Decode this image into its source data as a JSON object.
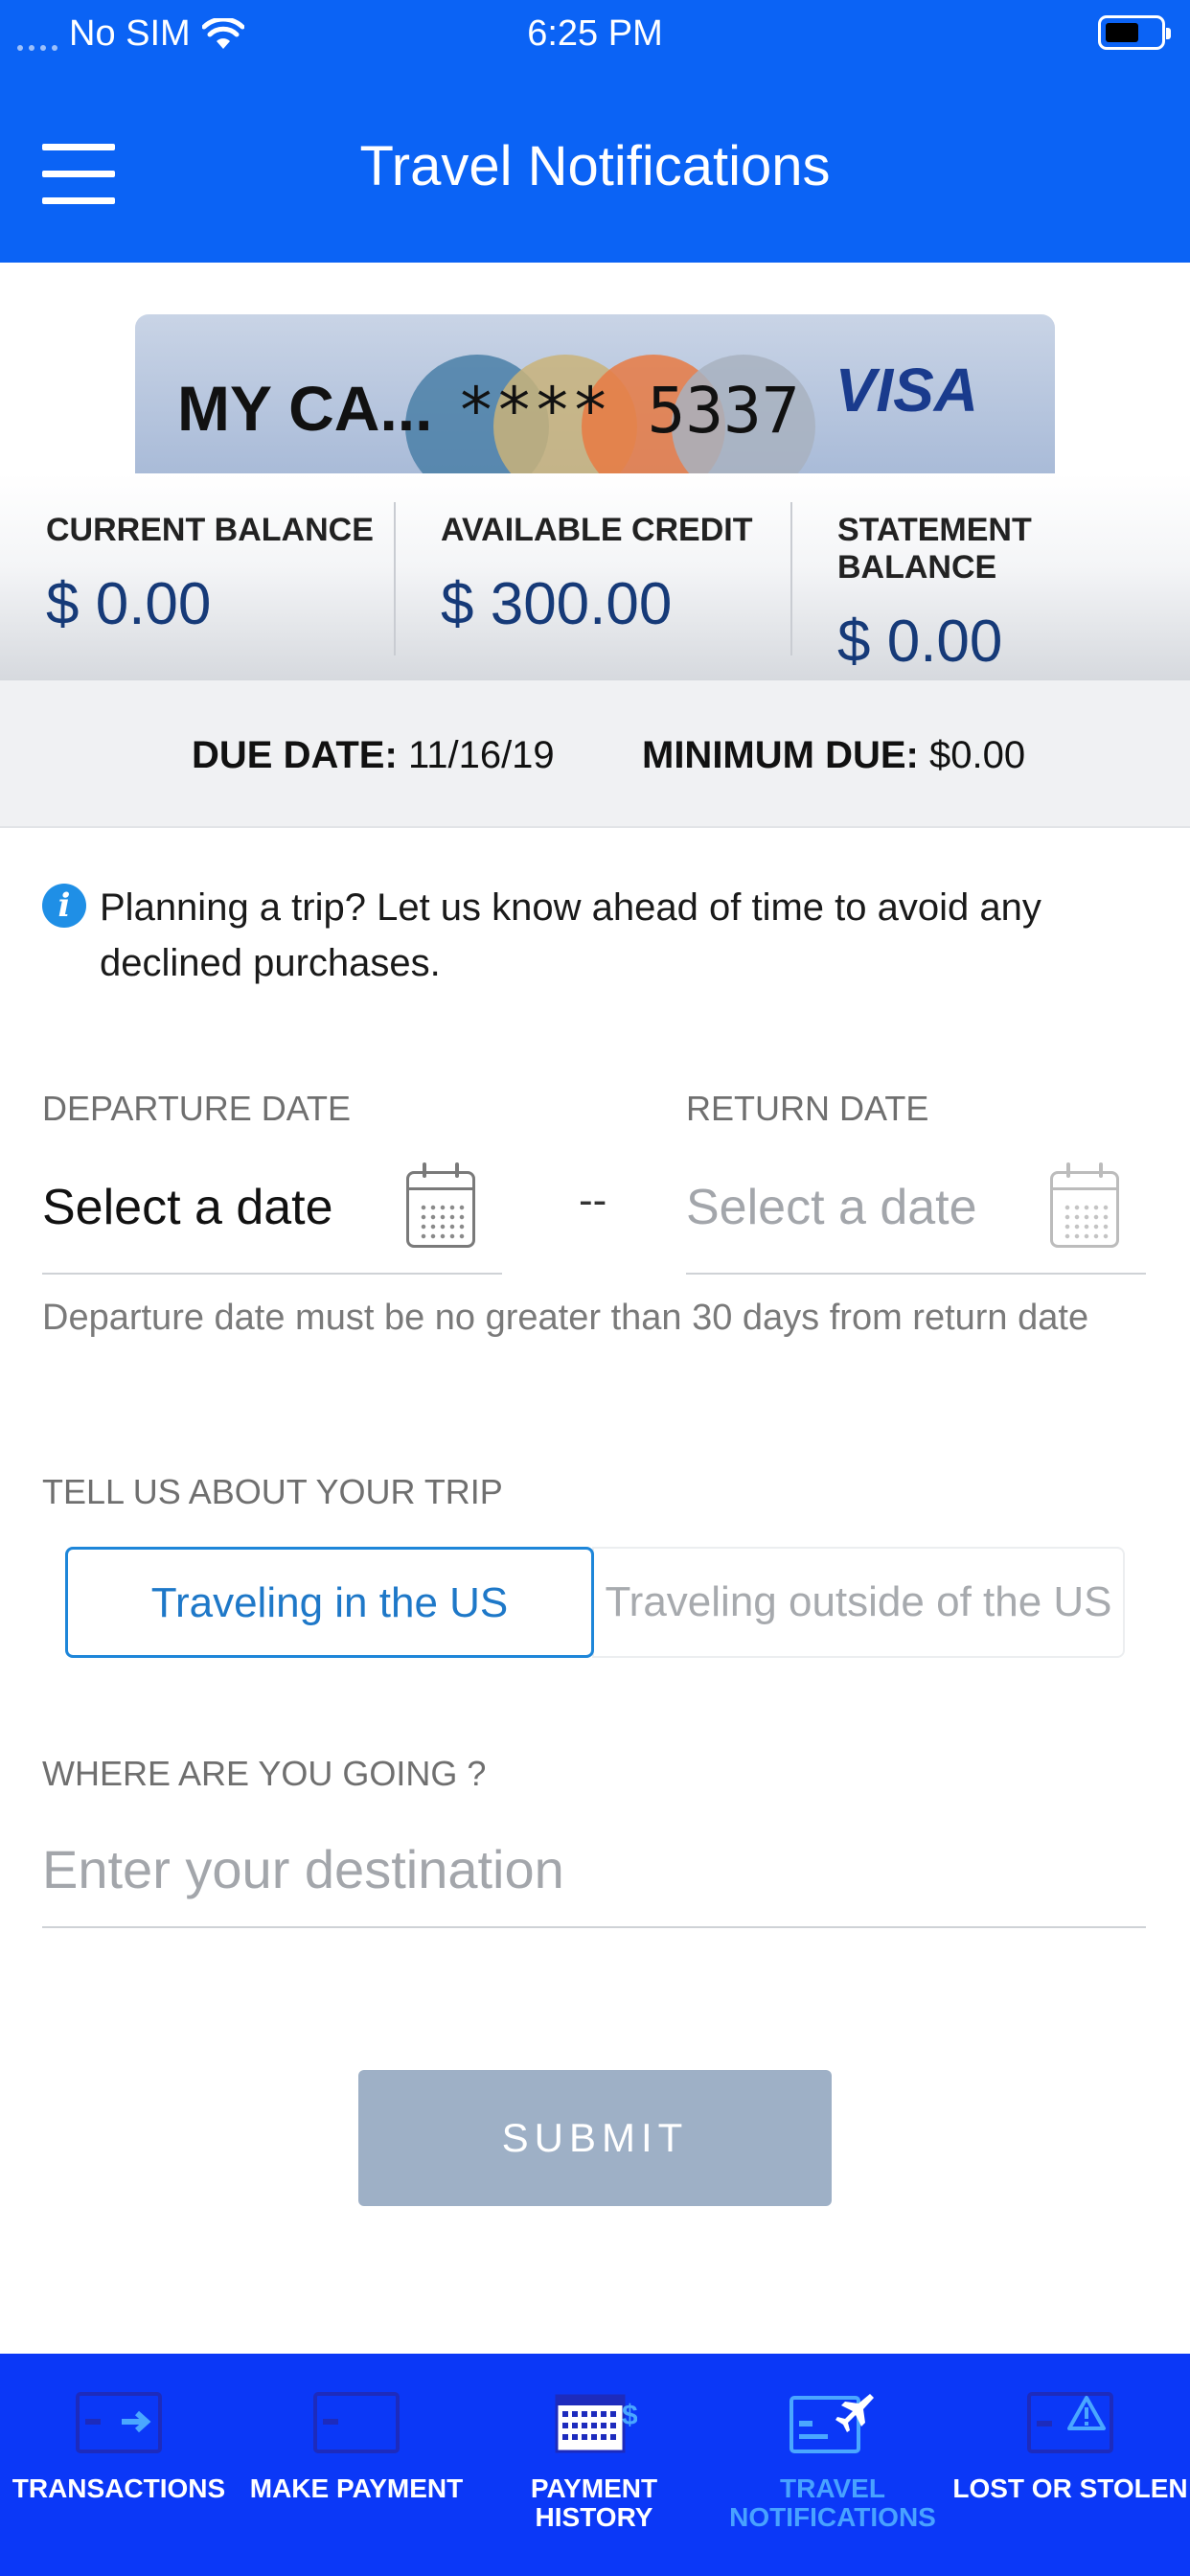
{
  "status_bar": {
    "carrier": "No SIM",
    "time": "6:25 PM"
  },
  "header": {
    "title": "Travel Notifications"
  },
  "card": {
    "name": "MY CA...",
    "number": "**** 5337",
    "brand": "VISA"
  },
  "balances": [
    {
      "label": "CURRENT BALANCE",
      "value": "$ 0.00"
    },
    {
      "label": "AVAILABLE CREDIT",
      "value": "$ 300.00"
    },
    {
      "label": "STATEMENT BALANCE",
      "value": "$ 0.00"
    }
  ],
  "due": {
    "due_label": "DUE DATE:",
    "due_value": "11/16/19",
    "min_label": "MINIMUM DUE:",
    "min_value": "$0.00"
  },
  "info": {
    "text": "Planning a trip? Let us know ahead of time to avoid any declined purchases."
  },
  "dates": {
    "departure_label": "DEPARTURE DATE",
    "departure_value": "Select a date",
    "separator": "--",
    "return_label": "RETURN DATE",
    "return_value": "Select a date",
    "hint": "Departure date must be no greater than 30 days from return date"
  },
  "trip": {
    "label": "TELL US ABOUT YOUR TRIP",
    "options": [
      "Traveling in the US",
      "Traveling outside of the US"
    ],
    "selected": "Traveling in the US"
  },
  "destination": {
    "label": "WHERE ARE YOU GOING ?",
    "placeholder": "Enter your destination",
    "value": ""
  },
  "submit_label": "SUBMIT",
  "tabs": [
    {
      "label": "TRANSACTIONS",
      "icon": "card-arrow-icon"
    },
    {
      "label": "MAKE PAYMENT",
      "icon": "card-icon"
    },
    {
      "label": "PAYMENT HISTORY",
      "icon": "calendar-dollar-icon"
    },
    {
      "label": "TRAVEL NOTIFICATIONS",
      "icon": "card-plane-icon",
      "active": true
    },
    {
      "label": "LOST OR STOLEN",
      "icon": "card-warning-icon"
    }
  ],
  "colors": {
    "brand_blue": "#0b63f5",
    "tab_bar": "#0b38f7",
    "active_tab": "#48a2ff",
    "accent": "#1e86d9",
    "submit_disabled": "#9eb0c6"
  }
}
